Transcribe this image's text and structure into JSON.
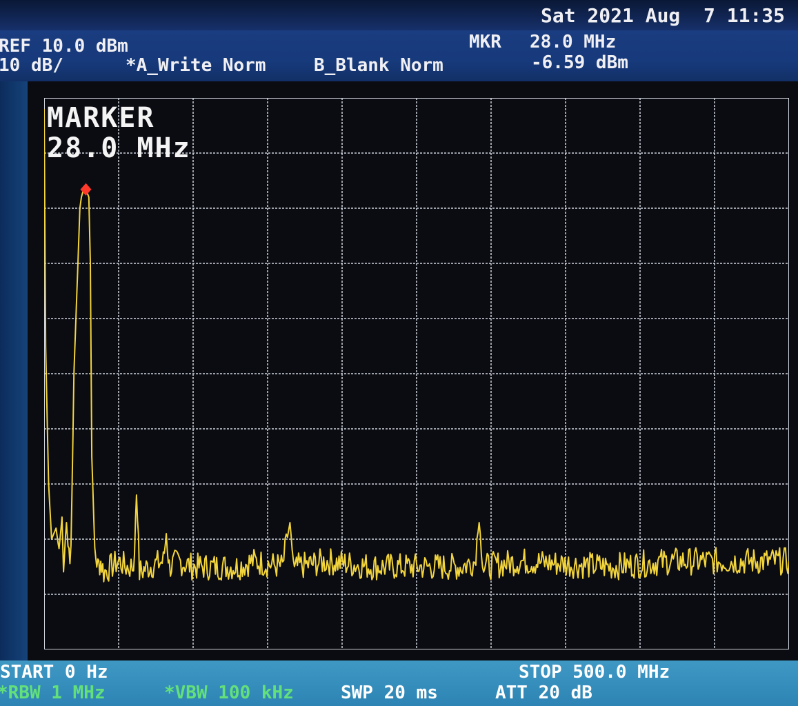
{
  "header": {
    "datetime": "Sat 2021 Aug  7 11:35",
    "ref_level": "REF 10.0 dBm",
    "scale": "10 dB/",
    "trace_a": "*A_Write Norm",
    "trace_b": "B_Blank Norm",
    "marker_label": "MKR",
    "marker_freq": "28.0 MHz",
    "marker_level": "-6.59 dBm"
  },
  "display": {
    "marker_title": "MARKER",
    "marker_freq": "28.0 MHz"
  },
  "footer": {
    "start": "START 0 Hz",
    "stop": "STOP 500.0 MHz",
    "rbw": "*RBW 1 MHz",
    "vbw": "*VBW 100 kHz",
    "sweep": "SWP 20 ms",
    "attenuation": "ATT 20 dB"
  },
  "colors": {
    "trace": "#f2d43c",
    "marker": "#ff3a2a",
    "grid": "#cfd3dc",
    "screen": "#0b0c12",
    "highlight_text": "#63e07a"
  },
  "chart_data": {
    "type": "line",
    "x_unit": "MHz",
    "y_unit": "dBm",
    "xlim": [
      0,
      500
    ],
    "ylim": [
      -90,
      10
    ],
    "grid": true,
    "x_divisions": 10,
    "y_divisions": 10,
    "marker": {
      "x": 28.0,
      "y": -6.59
    },
    "noise_floor": -75,
    "series": [
      {
        "x": [
          0,
          1,
          3,
          5,
          8,
          10,
          12,
          13,
          15,
          16,
          18,
          20,
          22,
          24,
          25,
          26,
          28,
          30,
          31,
          32,
          34,
          36,
          38,
          40,
          45,
          50,
          55,
          60,
          62,
          64,
          70,
          80,
          82,
          84,
          90,
          100,
          130,
          140,
          160,
          165,
          168,
          170,
          190,
          220,
          250,
          280,
          289,
          292,
          295,
          320,
          380,
          420,
          470,
          500
        ],
        "y": [
          8,
          -35,
          -60,
          -70,
          -68,
          -72,
          -66,
          -74,
          -67,
          -71,
          -73,
          -40,
          -25,
          -10,
          -8,
          -7,
          -6.59,
          -8,
          -20,
          -55,
          -72,
          -75,
          -74,
          -76,
          -75,
          -74,
          -75,
          -75,
          -62,
          -76,
          -75,
          -74,
          -69,
          -75,
          -74,
          -75,
          -75,
          -74,
          -75,
          -67,
          -76,
          -75,
          -74,
          -75,
          -75,
          -75,
          -74,
          -67,
          -75,
          -74,
          -75,
          -74,
          -74,
          -74
        ]
      }
    ]
  }
}
